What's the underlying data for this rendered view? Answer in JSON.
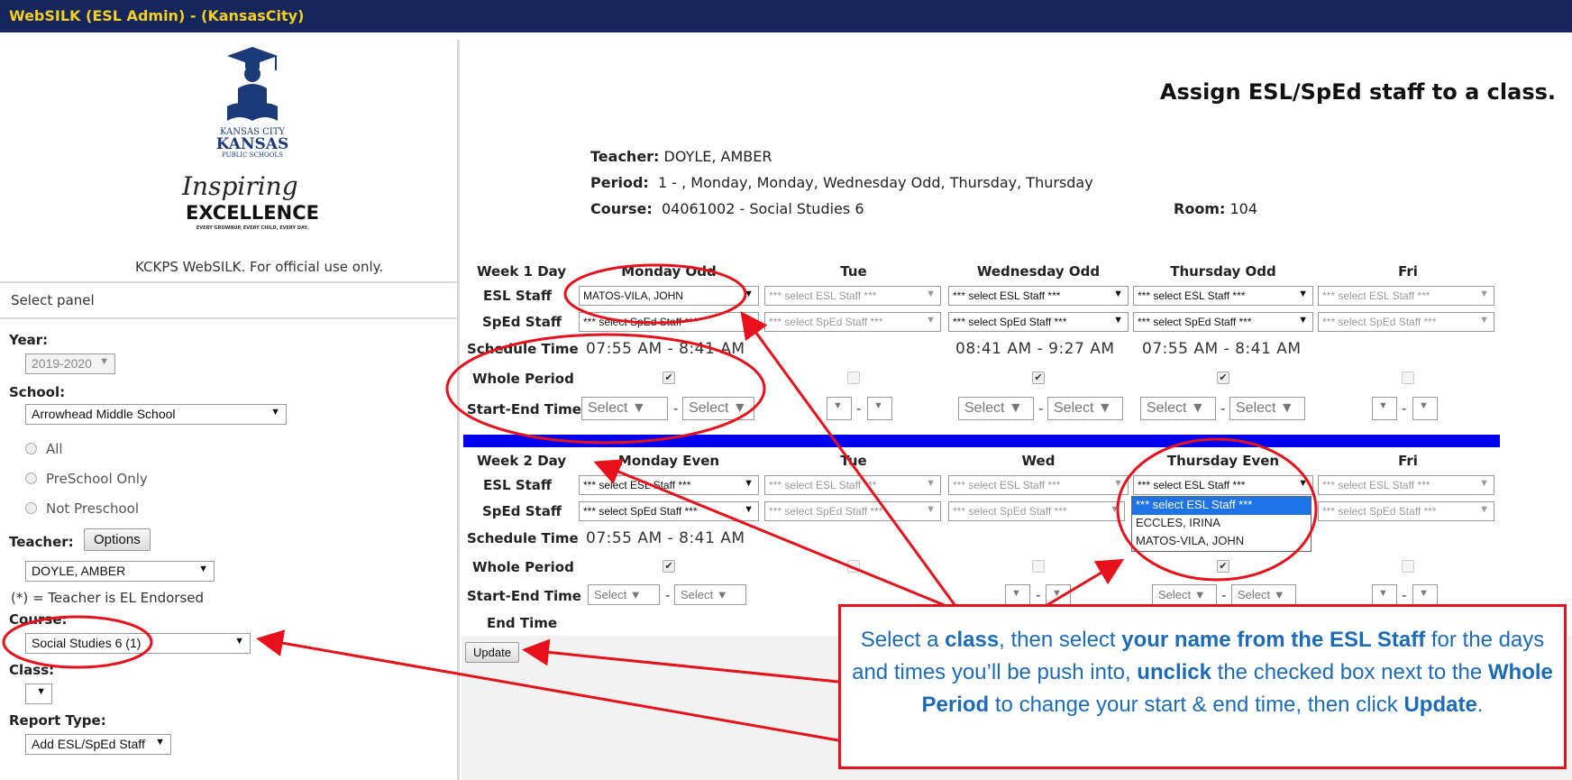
{
  "window": {
    "title": "WebSILK (ESL Admin) -  (KansasCity)"
  },
  "logo": {
    "line1": "KANSAS CITY",
    "line2": "KANSAS",
    "line3": "PUBLIC SCHOOLS",
    "script": "Inspiring",
    "word": "EXCELLENCE",
    "motto": "EVERY GROWNUP, EVERY CHILD, EVERY DAY."
  },
  "sidebar": {
    "tagline": "KCKPS WebSILK. For official use only.",
    "select_panel": "Select panel",
    "year_label": "Year:",
    "year_value": "2019-2020",
    "school_label": "School:",
    "school_value": "Arrowhead Middle School",
    "radios": [
      "All",
      "PreSchool Only",
      "Not Preschool"
    ],
    "teacher_label": "Teacher:",
    "options_button": "Options",
    "teacher_value": "DOYLE, AMBER",
    "endorsed_note": "(*) = Teacher is EL Endorsed",
    "course_label": "Course:",
    "course_value": "Social Studies 6 (1)",
    "class_label": "Class:",
    "report_label": "Report Type:",
    "report_value": "Add ESL/SpEd Staff"
  },
  "main": {
    "title": "Assign ESL/SpEd staff to a class.",
    "teacher_label": "Teacher:",
    "teacher_value": "DOYLE, AMBER",
    "period_label": "Period:",
    "period_value": "1 - , Monday, Monday, Wednesday Odd, Thursday, Thursday",
    "course_label": "Course:",
    "course_value": "04061002 - Social Studies 6",
    "room_label": "Room:",
    "room_value": "104",
    "row_labels": {
      "week1": "Week 1 Day",
      "week2": "Week 2 Day",
      "esl": "ESL Staff",
      "sped": "SpEd Staff",
      "schedule": "Schedule Time",
      "whole": "Whole Period",
      "startend": "Start-End Time",
      "endtime": "End Time"
    },
    "week1_days": [
      "Monday Odd",
      "Tue",
      "Wednesday Odd",
      "Thursday Odd",
      "Fri"
    ],
    "week2_days": [
      "Monday Even",
      "Tue",
      "Wed",
      "Thursday Even",
      "Fri"
    ],
    "esl_placeholder": "*** select ESL Staff ***",
    "sped_placeholder": "*** select SpEd Staff ***",
    "w1_esl_monday": "MATOS-VILA, JOHN",
    "w1_times": [
      "07:55 AM - 8:41 AM",
      "08:41 AM - 9:27 AM",
      "07:55 AM - 8:41 AM"
    ],
    "w2_time": "07:55 AM - 8:41 AM",
    "select_word": "Select",
    "dropdown_options": [
      "*** select ESL Staff ***",
      "ECCLES, IRINA",
      "MATOS-VILA, JOHN"
    ],
    "update_button": "Update"
  },
  "callout": {
    "t1": "Select a ",
    "b1": "class",
    "t2": ", then select ",
    "b2": "your name from the ESL Staff",
    "t3": " for the days and times you’ll be push into, ",
    "b3": "unclick",
    "t4": " the checked box next to the ",
    "b4": "Whole Period",
    "t5": " to change your start & end time, then click ",
    "b5": "Update",
    "t6": "."
  },
  "colors": {
    "titlebar": "#14265c",
    "title_text": "#f5d020",
    "annotation": "#e8101a",
    "callout_text": "#1c6bb8",
    "week_divider": "#0000ee"
  }
}
